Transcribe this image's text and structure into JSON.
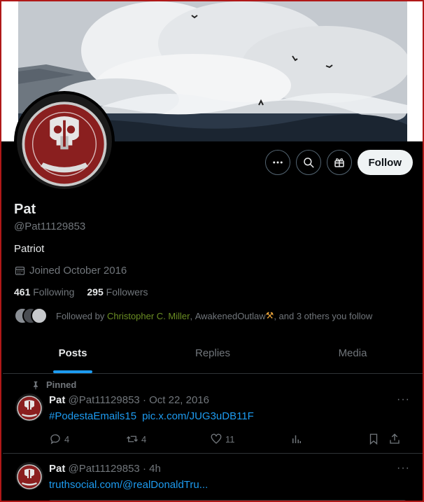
{
  "profile": {
    "name": "Pat",
    "handle": "@Pat11129853",
    "bio": "Patriot",
    "joined": "Joined October 2016",
    "following_count": "461",
    "following_label": "Following",
    "followers_count": "295",
    "followers_label": "Followers",
    "avatar_text": "COURT DAYS"
  },
  "actions": {
    "follow_label": "Follow"
  },
  "followed_by": {
    "prefix": "Followed by",
    "name1": "Christopher C. Miller",
    "name2": "AwakenedOutlaw",
    "emoji": "⚒",
    "suffix": ", and 3 others you follow"
  },
  "tabs": [
    {
      "label": "Posts"
    },
    {
      "label": "Replies"
    },
    {
      "label": "Media"
    }
  ],
  "posts": [
    {
      "pinned_label": "Pinned",
      "author": "Pat",
      "handle": "@Pat11129853",
      "sep": "·",
      "time": "Oct 22, 2016",
      "hashtag": "#PodestaEmails15",
      "link": "pic.x.com/JUG3uDB11F",
      "replies": "4",
      "reposts": "4",
      "likes": "11",
      "more": "···"
    },
    {
      "author": "Pat",
      "handle": "@Pat11129853",
      "sep": "·",
      "time": "4h",
      "link": "truthsocial.com/@realDonaldTru...",
      "more": "···"
    }
  ],
  "colors": {
    "accent": "#1d9bf0",
    "follower_link": "#6b8e23",
    "frame_border": "#b01818"
  }
}
